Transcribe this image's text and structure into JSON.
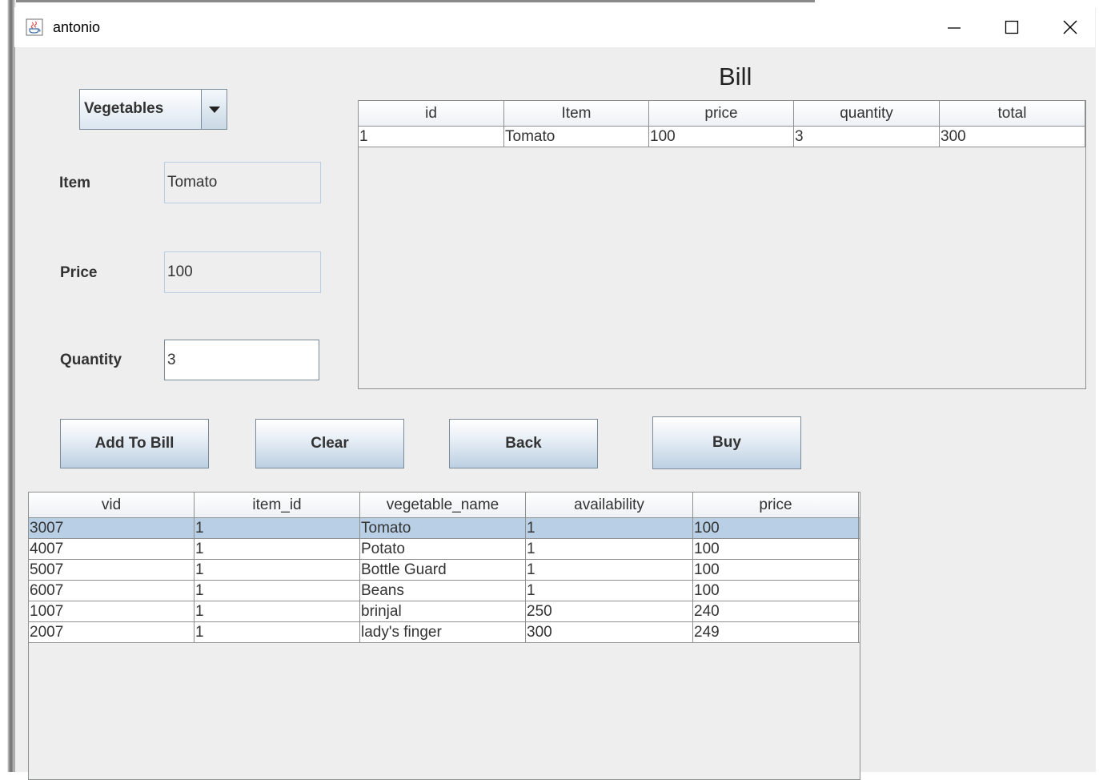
{
  "window": {
    "title": "antonio"
  },
  "form": {
    "category": "Vegetables",
    "item_label": "Item",
    "item_value": "Tomato",
    "price_label": "Price",
    "price_value": "100",
    "quantity_label": "Quantity",
    "quantity_value": "3"
  },
  "buttons": {
    "add": "Add To Bill",
    "clear": "Clear",
    "back": "Back",
    "buy": "Buy"
  },
  "bill": {
    "title": "Bill",
    "headers": [
      "id",
      "Item",
      "price",
      "quantity",
      "total"
    ],
    "rows": [
      [
        "1",
        "Tomato",
        "100",
        "3",
        "300"
      ]
    ]
  },
  "inventory": {
    "headers": [
      "vid",
      "item_id",
      "vegetable_name",
      "availability",
      "price"
    ],
    "rows": [
      [
        "3007",
        "1",
        "Tomato",
        "1",
        "100"
      ],
      [
        "4007",
        "1",
        "Potato",
        "1",
        "100"
      ],
      [
        "5007",
        "1",
        "Bottle Guard",
        "1",
        "100"
      ],
      [
        "6007",
        "1",
        "Beans",
        "1",
        "100"
      ],
      [
        "1007",
        "1",
        "brinjal",
        "250",
        "240"
      ],
      [
        "2007",
        "1",
        "lady's finger",
        "300",
        "249"
      ]
    ],
    "selected_row": 0
  },
  "colors": {
    "selection": "#b8cfe5",
    "panel": "#eeeeee",
    "border": "#8e8f8f"
  }
}
